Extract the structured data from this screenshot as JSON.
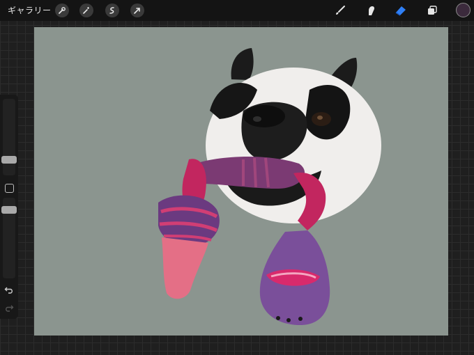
{
  "topbar": {
    "gallery_label": "ギャラリー",
    "tools_left": [
      "wrench-icon",
      "magic-wand-icon",
      "selection-icon",
      "transform-icon"
    ],
    "tools_right": [
      "brush-icon",
      "smudge-icon",
      "eraser-icon",
      "layers-icon"
    ],
    "active_tool": "eraser-icon",
    "current_color": "#3b2a3c"
  },
  "sidebar": {
    "brush_size": 0.15,
    "opacity": 0.55
  },
  "canvas": {
    "background": "#8b958f"
  },
  "colors": {
    "accent": "#2f7ff5",
    "topbar_bg": "#141414",
    "workspace_bg": "#1f1f1f"
  }
}
